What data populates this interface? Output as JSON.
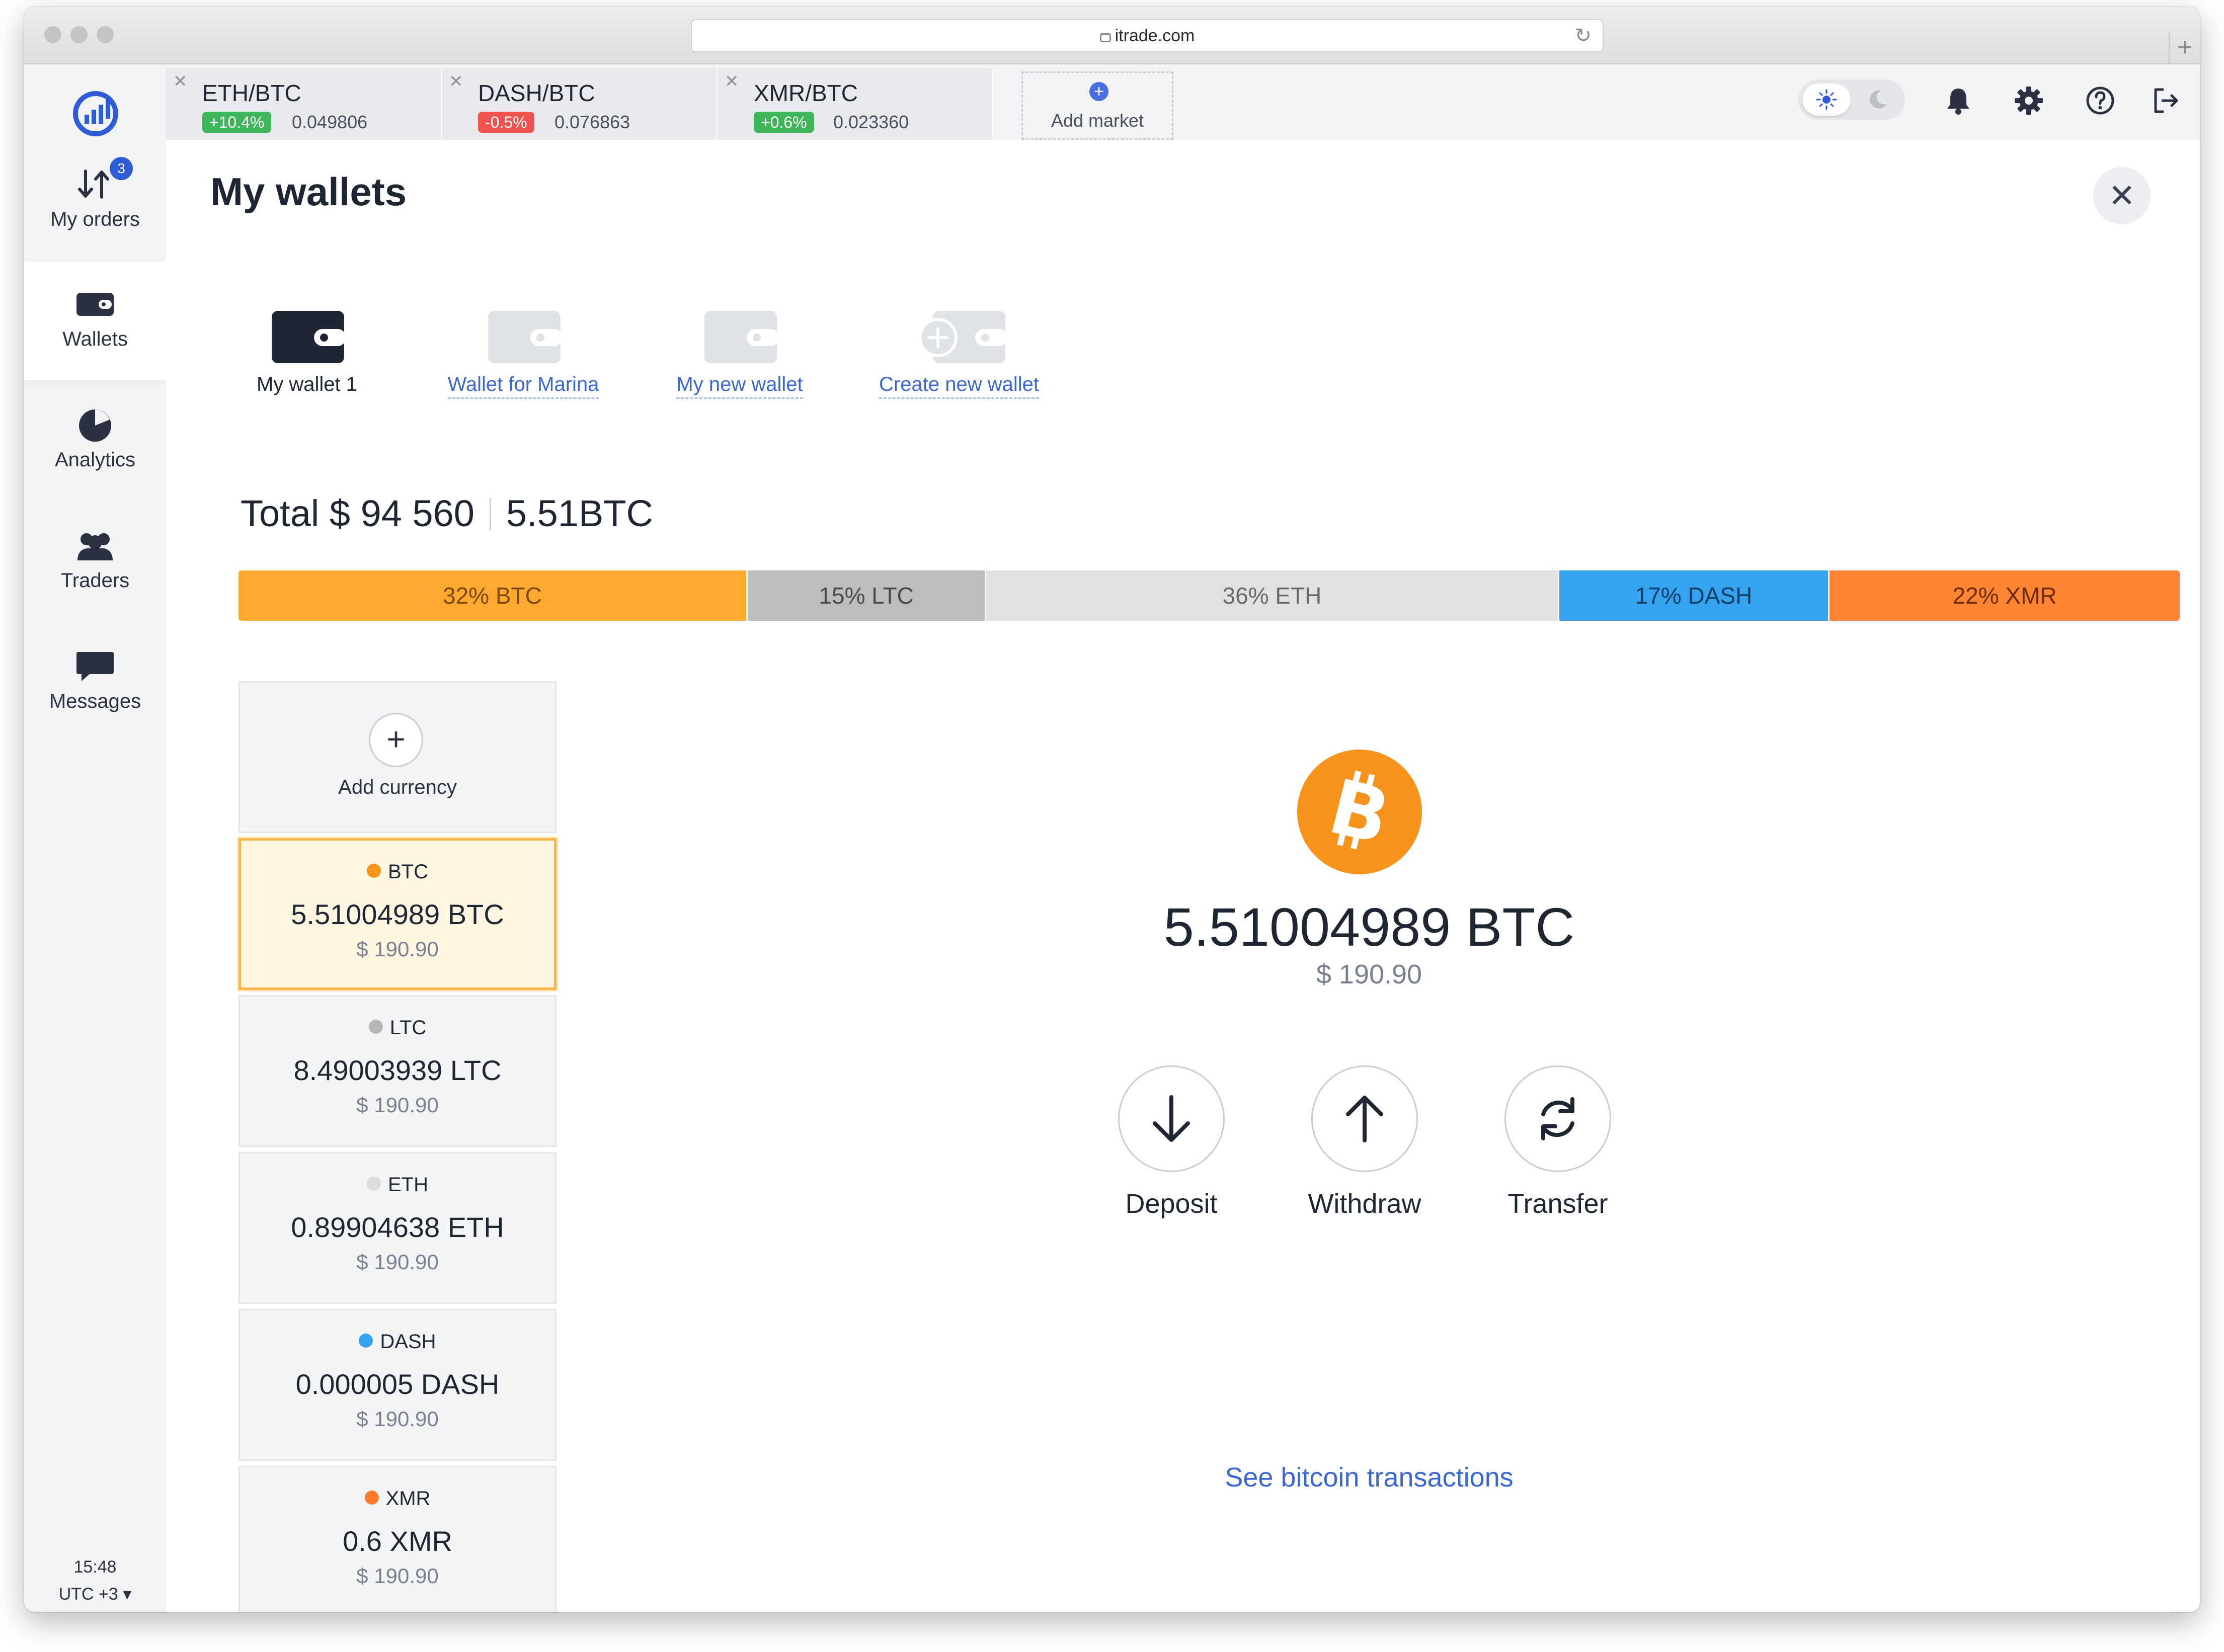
{
  "browser": {
    "url": "itrade.com"
  },
  "sidebar": {
    "items": [
      {
        "label": "My orders",
        "icon": "orders-arrows-icon",
        "badge": "3"
      },
      {
        "label": "Wallets",
        "icon": "wallet-icon"
      },
      {
        "label": "Analytics",
        "icon": "pie-chart-icon"
      },
      {
        "label": "Traders",
        "icon": "users-icon"
      },
      {
        "label": "Messages",
        "icon": "chat-bubble-icon"
      }
    ],
    "time": "15:48",
    "timezone": "UTC +3 ▾"
  },
  "market_tabs": [
    {
      "pair": "ETH/BTC",
      "change": "+10.4%",
      "price": "0.049806",
      "trend": "up"
    },
    {
      "pair": "DASH/BTC",
      "change": "-0.5%",
      "price": "0.076863",
      "trend": "down"
    },
    {
      "pair": "XMR/BTC",
      "change": "+0.6%",
      "price": "0.023360",
      "trend": "up"
    }
  ],
  "add_market_label": "Add market",
  "header_icons": [
    "sun-icon",
    "moon-icon",
    "bell-icon",
    "gear-icon",
    "help-icon",
    "logout-icon"
  ],
  "page": {
    "title": "My wallets",
    "close_icon": "close-icon"
  },
  "wallets": [
    {
      "label": "My wallet 1",
      "active": true
    },
    {
      "label": "Wallet for Marina",
      "active": false
    },
    {
      "label": "My new wallet",
      "active": false
    },
    {
      "label": "Create new wallet",
      "active": false
    }
  ],
  "total": {
    "usd": "Total $ 94 560",
    "btc": "5.51BTC"
  },
  "allocation": [
    {
      "label": "32% BTC",
      "percent": 32,
      "color": "#ffa930",
      "text_color": "#7a4a0a"
    },
    {
      "label": "15% LTC",
      "percent": 15,
      "color": "#bdbdbd",
      "text_color": "#4a4a4a"
    },
    {
      "label": "36% ETH",
      "percent": 36,
      "color": "#e1e1e1",
      "text_color": "#6a6a6a"
    },
    {
      "label": "17% DASH",
      "percent": 17,
      "color": "#35a3f0",
      "text_color": "#0d3f66"
    },
    {
      "label": "22% XMR",
      "percent": 22,
      "color": "#ff8434",
      "text_color": "#6e2c05"
    }
  ],
  "add_currency_label": "Add currency",
  "currencies": [
    {
      "symbol": "BTC",
      "amount": "5.51004989 BTC",
      "usd": "$ 190.90",
      "dot_color": "#f7931a",
      "selected": true
    },
    {
      "symbol": "LTC",
      "amount": "8.49003939 LTC",
      "usd": "$ 190.90",
      "dot_color": "#b5b5b5",
      "selected": false
    },
    {
      "symbol": "ETH",
      "amount": "0.89904638 ETH",
      "usd": "$ 190.90",
      "dot_color": "#dcdcdc",
      "selected": false
    },
    {
      "symbol": "DASH",
      "amount": "0.000005 DASH",
      "usd": "$ 190.90",
      "dot_color": "#35a3f0",
      "selected": false
    },
    {
      "symbol": "XMR",
      "amount": "0.6 XMR",
      "usd": "$ 190.90",
      "dot_color": "#ff7a2a",
      "selected": false
    }
  ],
  "detail": {
    "coin_icon": "bitcoin-icon",
    "amount": "5.51004989 BTC",
    "usd": "$ 190.90",
    "actions": [
      {
        "label": "Deposit",
        "icon": "arrow-down-icon"
      },
      {
        "label": "Withdraw",
        "icon": "arrow-up-icon"
      },
      {
        "label": "Transfer",
        "icon": "refresh-icon"
      }
    ],
    "transactions_link": "See bitcoin transactions"
  },
  "colors": {
    "link": "#3b66d6",
    "positive": "#3fb55a",
    "negative": "#ef5350",
    "accent": "#f7931a"
  }
}
